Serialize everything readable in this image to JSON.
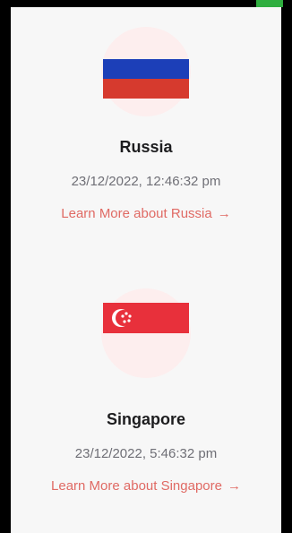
{
  "countries": [
    {
      "name": "Russia",
      "datetime": "23/12/2022, 12:46:32 pm",
      "link_label": "Learn More about Russia",
      "flag": {
        "name": "russia-flag",
        "colors": [
          "#ffffff",
          "#1c3fb8",
          "#d63a2e"
        ]
      }
    },
    {
      "name": "Singapore",
      "datetime": "23/12/2022, 5:46:32 pm",
      "link_label": "Learn More about Singapore",
      "flag": {
        "name": "singapore-flag",
        "colors": [
          "#e8303b",
          "#ffffff"
        ]
      }
    }
  ],
  "icons": {
    "arrow": "→"
  },
  "theme": {
    "accent": "#e06a64",
    "circle_tint": "#fdeeee",
    "top_corner_green": "#2fae3f"
  }
}
